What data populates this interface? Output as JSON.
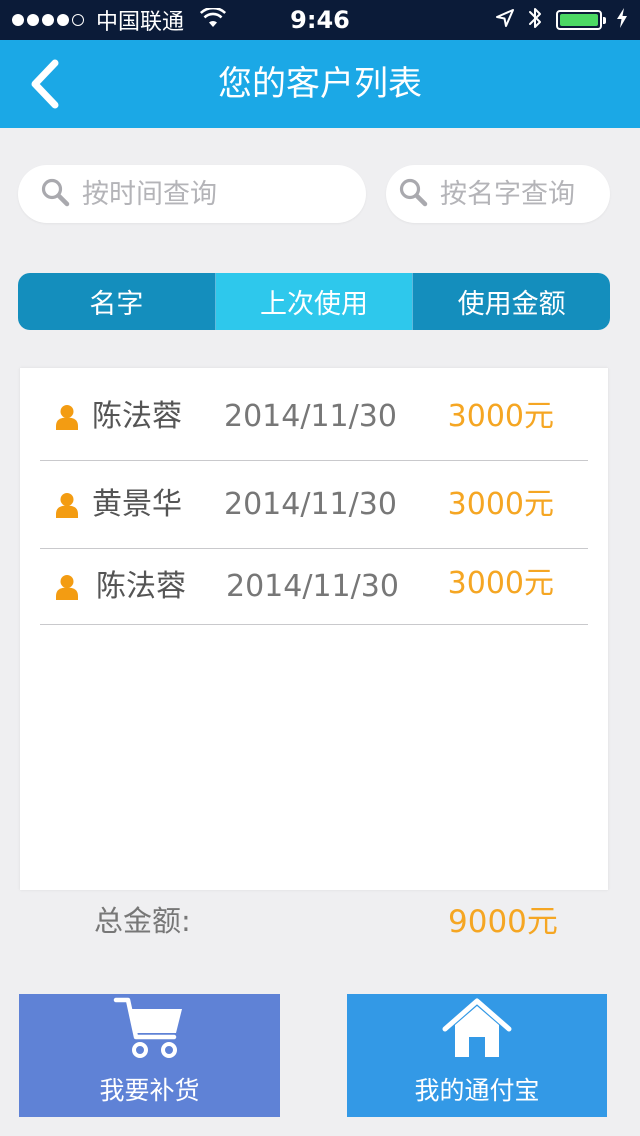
{
  "status_bar": {
    "signal_dots": 5,
    "signal_filled": 4,
    "carrier": "中国联通",
    "time": "9:46",
    "battery_level": 0.85
  },
  "nav": {
    "title": "您的客户列表",
    "back_icon": "chevron-left-icon"
  },
  "search": {
    "by_time_placeholder": "按时间查询",
    "by_name_placeholder": "按名字查询"
  },
  "tabs": [
    {
      "label": "名字",
      "active": false
    },
    {
      "label": "上次使用",
      "active": true
    },
    {
      "label": "使用金额",
      "active": false
    }
  ],
  "customers": [
    {
      "name": "陈法蓉",
      "date": "2014/11/30",
      "amount": "3000元"
    },
    {
      "name": "黄景华",
      "date": "2014/11/30",
      "amount": "3000元"
    },
    {
      "name": "陈法蓉",
      "date": "2014/11/30",
      "amount": "3000元"
    }
  ],
  "total": {
    "label": "总金额:",
    "value": "9000元"
  },
  "actions": {
    "restock_label": "我要补货",
    "wallet_label": "我的通付宝"
  },
  "colors": {
    "nav": "#1ba8e6",
    "accent_orange": "#f5a623",
    "tab_bg": "#148ebd",
    "tab_active": "#2ec8ec",
    "restock_btn": "#5f82d6",
    "wallet_btn": "#3399e6"
  }
}
